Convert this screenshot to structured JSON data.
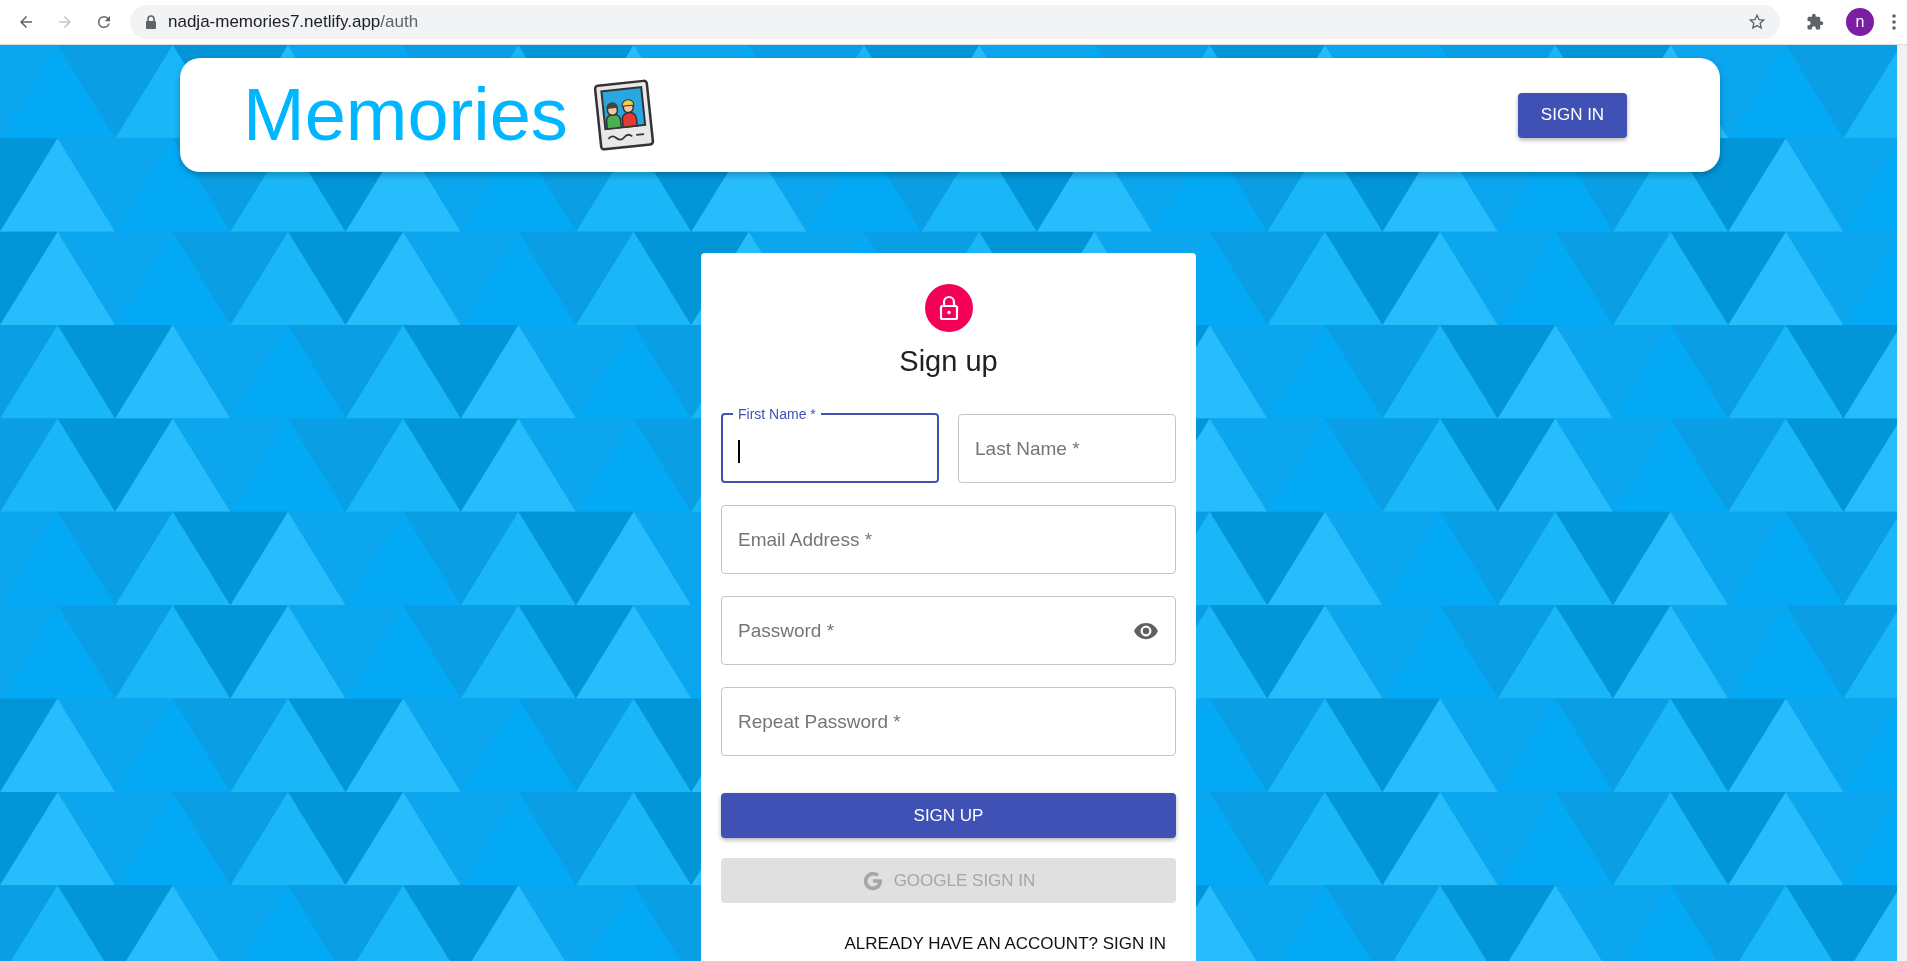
{
  "browser": {
    "url_host": "nadja-memories7.netlify.app",
    "url_path": "/auth",
    "forward_disabled": true,
    "profile_initial": "n"
  },
  "header": {
    "title": "Memories",
    "button": "SIGN IN"
  },
  "form": {
    "title": "Sign up",
    "fields": [
      {
        "label": "First Name *",
        "kind": "half",
        "focused": true,
        "has_toggle": false
      },
      {
        "label": "Last Name *",
        "kind": "half",
        "focused": false,
        "has_toggle": false
      },
      {
        "label": "Email Address *",
        "kind": "full",
        "focused": false,
        "has_toggle": false
      },
      {
        "label": "Password *",
        "kind": "full",
        "focused": false,
        "has_toggle": true
      },
      {
        "label": "Repeat Password *",
        "kind": "full",
        "focused": false,
        "has_toggle": false
      }
    ],
    "submit_button": "SIGN UP",
    "google_button": {
      "label": "GOOGLE SIGN IN",
      "disabled": true
    },
    "switch_link": "ALREADY HAVE AN ACCOUNT? SIGN IN"
  }
}
